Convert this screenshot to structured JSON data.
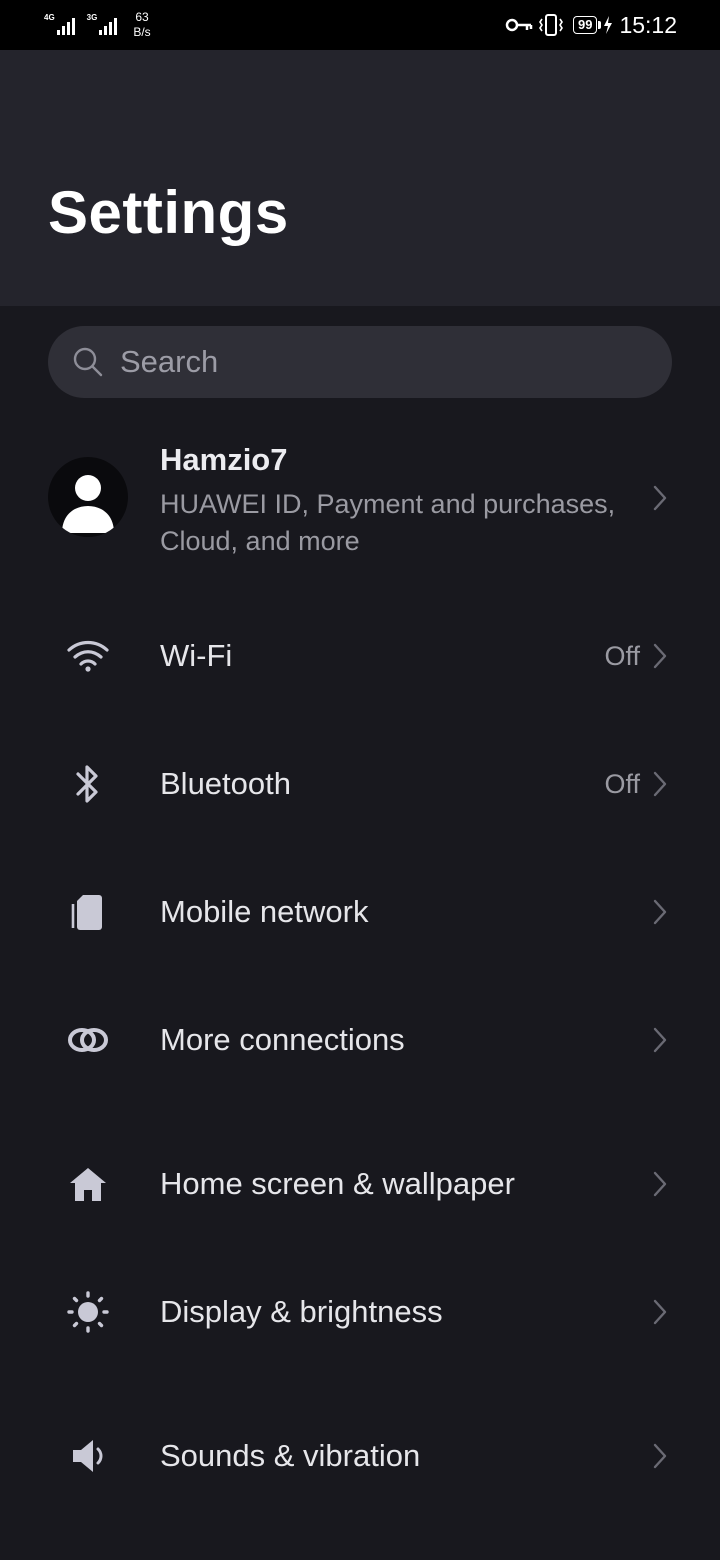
{
  "status_bar": {
    "sim1_label": "4G",
    "sim2_label": "3G",
    "speed_value": "63",
    "speed_unit": "B/s",
    "battery": "99",
    "time": "15:12"
  },
  "header": {
    "title": "Settings"
  },
  "search": {
    "placeholder": "Search"
  },
  "account": {
    "name": "Hamzio7",
    "subtitle": "HUAWEI ID, Payment and purchases, Cloud, and more"
  },
  "rows": [
    {
      "label": "Wi-Fi",
      "value": "Off",
      "icon": "wifi-icon"
    },
    {
      "label": "Bluetooth",
      "value": "Off",
      "icon": "bluetooth-icon"
    },
    {
      "label": "Mobile network",
      "value": "",
      "icon": "mobile-network-icon"
    },
    {
      "label": "More connections",
      "value": "",
      "icon": "more-connections-icon"
    },
    {
      "label": "Home screen & wallpaper",
      "value": "",
      "icon": "home-icon"
    },
    {
      "label": "Display & brightness",
      "value": "",
      "icon": "brightness-icon"
    },
    {
      "label": "Sounds & vibration",
      "value": "",
      "icon": "speaker-icon"
    }
  ],
  "colors": {
    "background": "#18181e",
    "header": "#24242c",
    "search_field": "#2f2f37",
    "icon": "#c9c9d6",
    "secondary_text": "#9a9aa2"
  }
}
